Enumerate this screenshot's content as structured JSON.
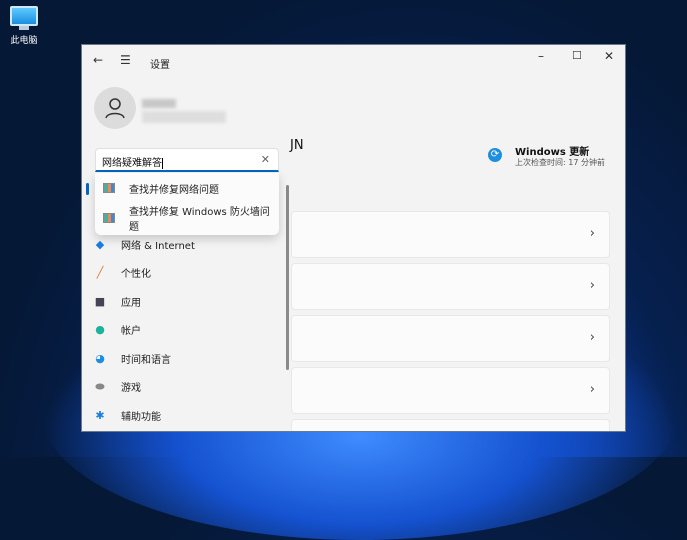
{
  "desktop": {
    "icon_label": "此电脑"
  },
  "window": {
    "title": "设置",
    "controls": [
      "minimize",
      "maximize",
      "close"
    ]
  },
  "profile": {
    "name_fragment": "JN"
  },
  "search": {
    "value": "网络疑难解答",
    "results": [
      "查找并修复网络问题",
      "查找并修复 Windows 防火墙问题"
    ]
  },
  "nav": {
    "items": [
      {
        "label": "网络 & Internet",
        "icon": "wifi-icon"
      },
      {
        "label": "个性化",
        "icon": "brush-icon"
      },
      {
        "label": "应用",
        "icon": "apps-icon"
      },
      {
        "label": "帐户",
        "icon": "person-icon"
      },
      {
        "label": "时间和语言",
        "icon": "globe-clock-icon"
      },
      {
        "label": "游戏",
        "icon": "gamepad-icon"
      },
      {
        "label": "辅助功能",
        "icon": "accessibility-icon"
      }
    ]
  },
  "update": {
    "title": "Windows 更新",
    "subtitle": "上次检查时间: 17 分钟前"
  },
  "colors": {
    "accent": "#0067c0"
  }
}
